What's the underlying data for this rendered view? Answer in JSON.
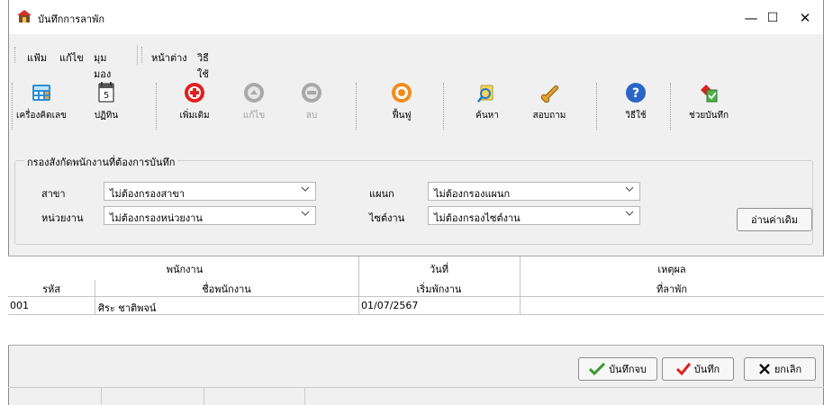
{
  "window": {
    "title": "บันทึกการลาพัก",
    "controls": {
      "minimize": "—",
      "maximize": "☐",
      "close": "✕"
    }
  },
  "menu": {
    "items": [
      "แฟ้ม",
      "แก้ไข",
      "มุมมอง",
      "หน้าต่าง",
      "วิธีใช้"
    ]
  },
  "toolbar": {
    "items": [
      {
        "label": "เครื่องคิดเลข",
        "icon": "calculator-icon",
        "enabled": true
      },
      {
        "label": "ปฏิทิน",
        "icon": "calendar-icon",
        "enabled": true
      },
      {
        "label": "เพิ่มเติม",
        "icon": "add-icon",
        "enabled": true
      },
      {
        "label": "แก้ไข",
        "icon": "edit-icon",
        "enabled": false
      },
      {
        "label": "ลบ",
        "icon": "delete-icon",
        "enabled": false
      },
      {
        "label": "ฟื้นฟู",
        "icon": "refresh-icon",
        "enabled": true
      },
      {
        "label": "ค้นหา",
        "icon": "search-icon",
        "enabled": true
      },
      {
        "label": "สอบถาม",
        "icon": "inquiry-icon",
        "enabled": true
      },
      {
        "label": "วิธีใช้",
        "icon": "help-icon",
        "enabled": true
      },
      {
        "label": "ช่วยบันทึก",
        "icon": "assist-icon",
        "enabled": true
      }
    ]
  },
  "filter": {
    "legend": "กรองสังกัดพนักงานที่ต้องการบันทึก",
    "branch_label": "สาขา",
    "branch_value": "ไม่ต้องกรองสาขา",
    "unit_label": "หน่วยงาน",
    "unit_value": "ไม่ต้องกรองหน่วยงาน",
    "department_label": "แผนก",
    "department_value": "ไม่ต้องกรองแผนก",
    "workgroup_label": "ไซต์งาน",
    "workgroup_value": "ไม่ต้องกรองไซต์งาน",
    "load_button": "อ่านค่าเดิม"
  },
  "grid": {
    "header": {
      "employee_group": "พนักงาน",
      "date_group": "วันที่",
      "reason_group": "เหตุผล",
      "code": "รหัส",
      "name": "ชื่อพนักงาน",
      "start_date": "เริ่มพักงาน",
      "reason": "ที่ลาพัก"
    },
    "rows": [
      {
        "code": "001",
        "name": "ศิระ  ชาติพจน์",
        "start_date": "01/07/2567",
        "reason": ""
      }
    ]
  },
  "actions": {
    "save_close": "บันทึกจบ",
    "save": "บันทึก",
    "cancel": "ยกเลิก"
  },
  "colors": {
    "accent_red": "#e02020",
    "accent_orange": "#f28c1c",
    "check_green": "#3a9a2a",
    "help_blue": "#2a66c8"
  }
}
